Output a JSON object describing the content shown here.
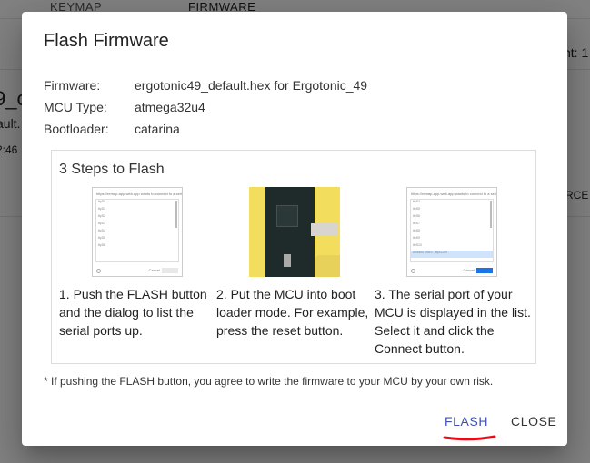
{
  "background": {
    "tabs": [
      "KEYMAP",
      "FIRMWARE"
    ],
    "fragments": {
      "name": "9_c",
      "sub": "ault.",
      "time": "2:46",
      "count": "nt: 1",
      "action": "RCE C"
    }
  },
  "dialog": {
    "title": "Flash Firmware",
    "info": [
      {
        "label": "Firmware:",
        "value": "ergotonic49_default.hex for Ergotonic_49"
      },
      {
        "label": "MCU Type:",
        "value": "atmega32u4"
      },
      {
        "label": "Bootloader:",
        "value": "catarina"
      }
    ],
    "steps_title": "3 Steps to Flash",
    "steps": [
      {
        "text": "1. Push the FLASH button and the dialog to list the serial ports up."
      },
      {
        "text": "2. Put the MCU into boot loader mode. For example, press the reset button."
      },
      {
        "text": "3. The serial port of your MCU is displayed in the list. Select it and click the Connect button."
      }
    ],
    "footnote": "* If pushing the FLASH button, you agree to write the firmware to your MCU by your own risk.",
    "buttons": {
      "flash": "FLASH",
      "close": "CLOSE"
    }
  },
  "colors": {
    "accent": "#3f51b5",
    "annotation": "#e0101a"
  }
}
